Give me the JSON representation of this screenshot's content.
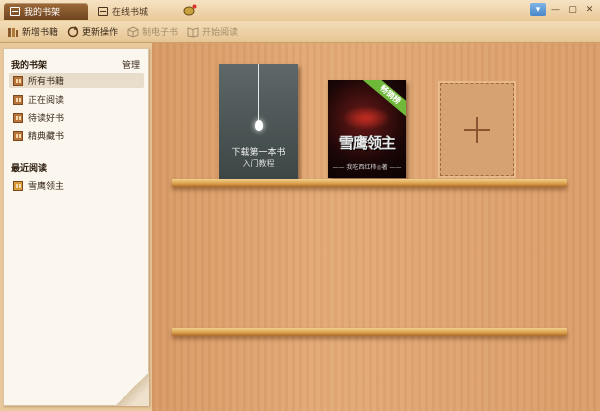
{
  "tabs": {
    "shelf_label": "我的书架",
    "store_label": "在线书城"
  },
  "toolbar": {
    "add_label": "新增书籍",
    "update_label": "更新操作",
    "make_ebook_label": "制电子书",
    "start_reading_label": "开始阅读"
  },
  "sidebar": {
    "shelf_header": "我的书架",
    "manage_label": "管理",
    "items": [
      {
        "label": "所有书籍"
      },
      {
        "label": "正在阅读"
      },
      {
        "label": "待读好书"
      },
      {
        "label": "精典藏书"
      }
    ],
    "recent_header": "最近阅读",
    "recent_items": [
      {
        "label": "雪鹰领主"
      }
    ]
  },
  "shelf": {
    "placeholder_book": {
      "title": "下载第一本书",
      "subtitle": "入门教程"
    },
    "book": {
      "title": "雪鹰领主",
      "ribbon": "畅销榜",
      "author": "—— 我吃西红柿◎著 ——"
    }
  },
  "colors": {
    "wood": "#e2aa77",
    "sidebar_bg": "#fbf6ee",
    "active_tab": "#7a4e26",
    "ribbon": "#6fb83a"
  }
}
